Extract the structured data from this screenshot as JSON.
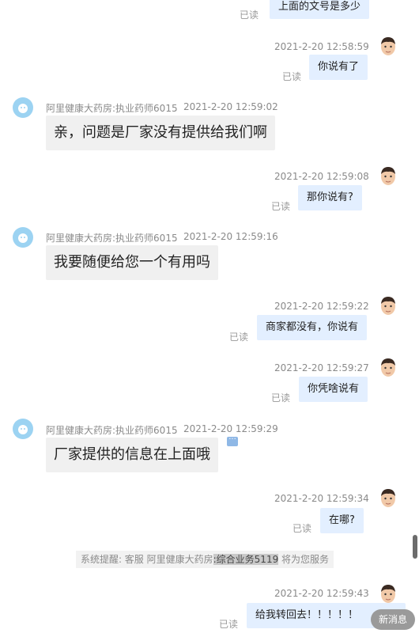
{
  "messages": [
    {
      "side": "right",
      "text": "上面的文号是多少",
      "read": "已读"
    },
    {
      "side": "right",
      "time": "2021-2-20 12:58:59",
      "text": "你说有了",
      "read": "已读"
    },
    {
      "side": "left",
      "sender": "阿里健康大药房:执业药师6015",
      "time": "2021-2-20 12:59:02",
      "text": "亲，问题是厂家没有提供给我们啊"
    },
    {
      "side": "right",
      "time": "2021-2-20 12:59:08",
      "text": "那你说有?",
      "read": "已读"
    },
    {
      "side": "left",
      "sender": "阿里健康大药房:执业药师6015",
      "time": "2021-2-20 12:59:16",
      "text": "我要随便给您一个有用吗"
    },
    {
      "side": "right",
      "time": "2021-2-20 12:59:22",
      "text": "商家都没有，你说有",
      "read": "已读"
    },
    {
      "side": "right",
      "time": "2021-2-20 12:59:27",
      "text": "你凭啥说有",
      "read": "已读"
    },
    {
      "side": "left",
      "sender": "阿里健康大药房:执业药师6015",
      "time": "2021-2-20 12:59:29",
      "text": "厂家提供的信息在上面哦"
    },
    {
      "side": "right",
      "time": "2021-2-20 12:59:34",
      "text": "在哪?",
      "read": "已读"
    },
    {
      "side": "right",
      "time": "2021-2-20 12:59:43",
      "text": "给我转回去！！！！！",
      "read": "已读"
    }
  ],
  "system_note": {
    "prefix": "系统提醒: 客服 阿里健康大药房",
    "highlight": ":综合业务5119",
    "suffix": " 将为您服务"
  },
  "new_message_button": "新消息",
  "colors": {
    "bubble_right": "#e3efff",
    "bubble_left": "#f0f0f0",
    "avatar_left": "#9cd3f2"
  }
}
